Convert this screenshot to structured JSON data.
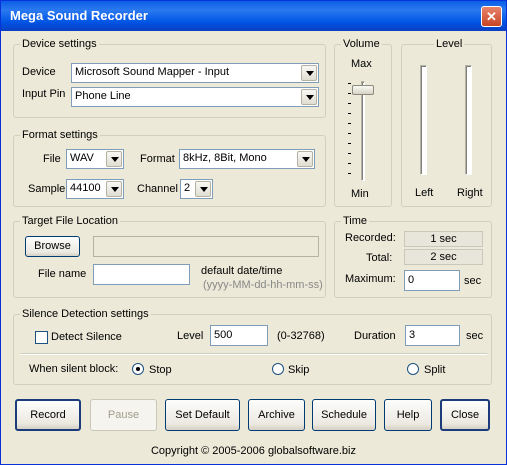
{
  "window": {
    "title": "Mega Sound Recorder"
  },
  "device_settings": {
    "legend": "Device settings",
    "device_label": "Device",
    "device_value": "Microsoft Sound Mapper - Input",
    "input_pin_label": "Input Pin",
    "input_pin_value": "Phone Line"
  },
  "volume": {
    "legend": "Volume",
    "max_label": "Max",
    "min_label": "Min",
    "level_fraction": 0.95
  },
  "level": {
    "legend": "Level",
    "left_label": "Left",
    "right_label": "Right"
  },
  "format_settings": {
    "legend": "Format settings",
    "file_label": "File",
    "file_value": "WAV",
    "format_label": "Format",
    "format_value": "8kHz, 8Bit, Mono",
    "sample_label": "Sample",
    "sample_value": "44100",
    "channel_label": "Channel",
    "channel_value": "2"
  },
  "target_file": {
    "legend": "Target File Location",
    "browse_label": "Browse",
    "path_value": "",
    "file_name_label": "File name",
    "file_name_value": "",
    "default_label": "default date/time",
    "default_format": "(yyyy-MM-dd-hh-mm-ss)"
  },
  "time": {
    "legend": "Time",
    "recorded_label": "Recorded:",
    "recorded_value": "1 sec",
    "total_label": "Total:",
    "total_value": "2 sec",
    "maximum_label": "Maximum:",
    "maximum_value": "0",
    "maximum_unit": "sec"
  },
  "silence": {
    "legend": "Silence Detection settings",
    "detect_label": "Detect Silence",
    "level_label": "Level",
    "level_value": "500",
    "level_range": "(0-32768)",
    "duration_label": "Duration",
    "duration_value": "3",
    "duration_unit": "sec",
    "silent_block_label": "When silent block:",
    "options": [
      "Stop",
      "Skip",
      "Split"
    ],
    "selected": "Stop"
  },
  "buttons": {
    "record": "Record",
    "pause": "Pause",
    "set_default": "Set Default",
    "archive": "Archive",
    "schedule": "Schedule",
    "help": "Help",
    "close": "Close"
  },
  "footer": "Copyright © 2005-2006 globalsoftware.biz"
}
